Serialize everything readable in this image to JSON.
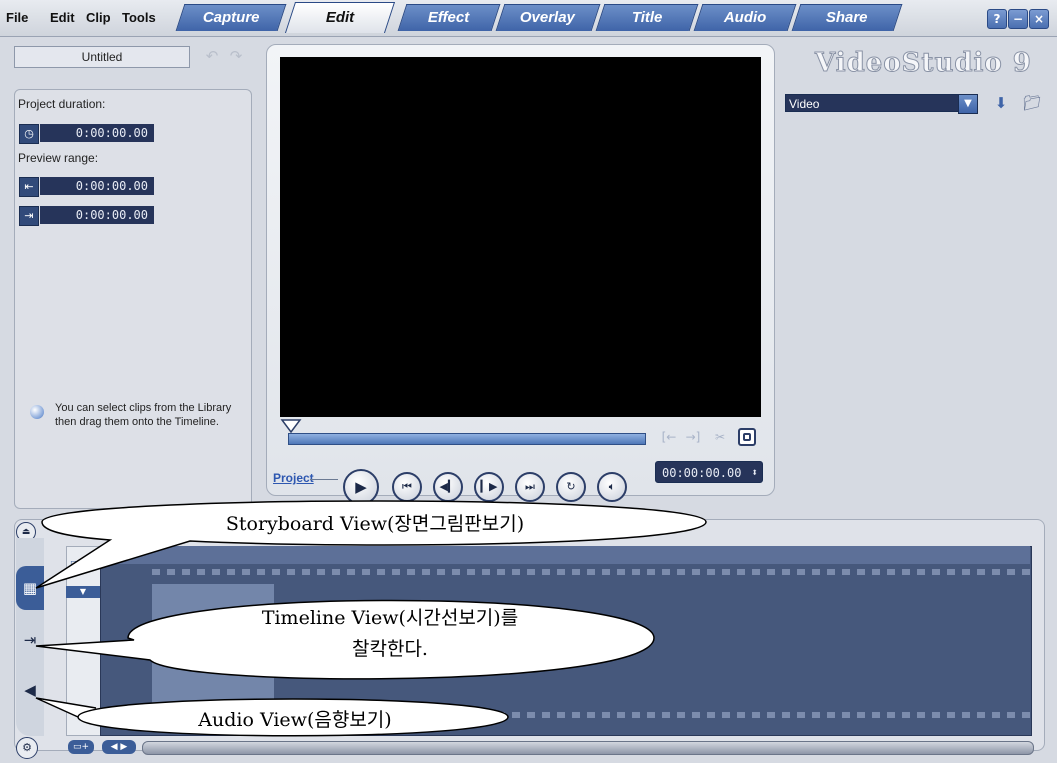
{
  "menu": [
    "File",
    "Edit",
    "Clip",
    "Tools"
  ],
  "tabs": [
    {
      "label": "Capture",
      "active": false
    },
    {
      "label": "Edit",
      "active": true
    },
    {
      "label": "Effect",
      "active": false
    },
    {
      "label": "Overlay",
      "active": false
    },
    {
      "label": "Title",
      "active": false
    },
    {
      "label": "Audio",
      "active": false
    },
    {
      "label": "Share",
      "active": false
    }
  ],
  "window_buttons": [
    "?",
    "−",
    "×"
  ],
  "project": {
    "name": "Untitled",
    "duration_label": "Project duration:",
    "duration": "0:00:00.00",
    "preview_range_label": "Preview range:",
    "range_start": "0:00:00.00",
    "range_end": "0:00:00.00",
    "tip": "You can select clips from the Library then drag them onto the Timeline."
  },
  "preview": {
    "timecode": "00:00:00.00",
    "mode_label": "Project"
  },
  "branding": {
    "logo": "VideoStudio 9"
  },
  "library": {
    "selected": "Video"
  },
  "callouts": {
    "storyboard": "Storyboard View(장면그림판보기)",
    "timeline_line1": "Timeline View(시간선보기)를",
    "timeline_line2": "찰칵한다.",
    "audio": "Audio View(음향보기)"
  },
  "colors": {
    "accent": "#3f64a8",
    "timecode_bg": "#26345a",
    "track_bg": "#46587c"
  }
}
